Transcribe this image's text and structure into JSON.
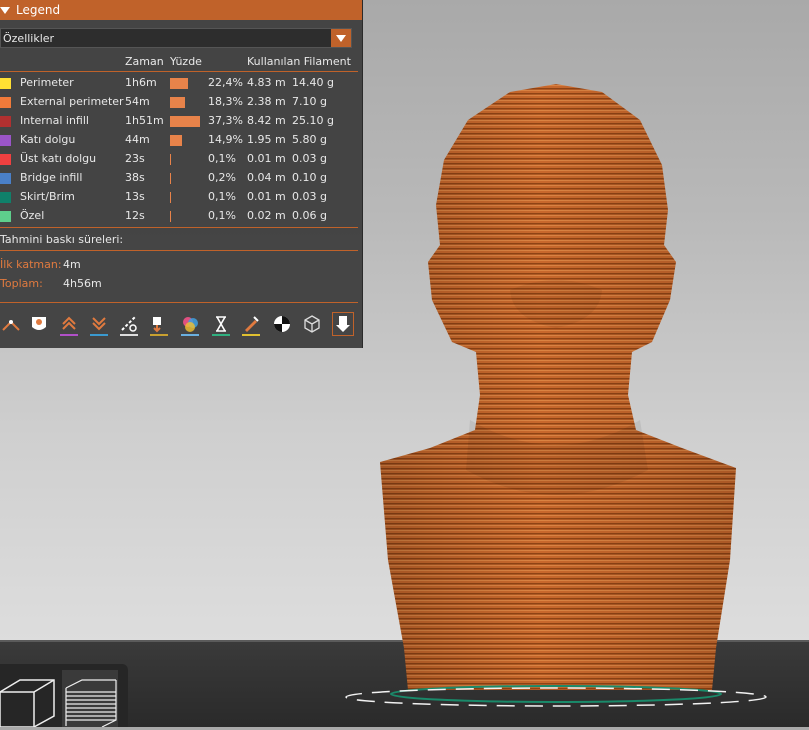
{
  "legend": {
    "title": "Legend",
    "view_select": "Özellikler",
    "columns": {
      "time": "Zaman",
      "percent": "Yüzde",
      "filament": "Kullanılan Filament"
    },
    "rows": [
      {
        "name": "Perimeter",
        "color": "#ffe033",
        "time": "1h6m",
        "percent_value": 22.4,
        "percent": "22,4%",
        "length": "4.83 m",
        "weight": "14.40 g"
      },
      {
        "name": "External perimeter",
        "color": "#f07a3a",
        "time": "54m",
        "percent_value": 18.3,
        "percent": "18,3%",
        "length": "2.38 m",
        "weight": "7.10 g"
      },
      {
        "name": "Internal infill",
        "color": "#b03030",
        "time": "1h51m",
        "percent_value": 37.3,
        "percent": "37,3%",
        "length": "8.42 m",
        "weight": "25.10 g"
      },
      {
        "name": "Katı dolgu",
        "color": "#9a55c8",
        "time": "44m",
        "percent_value": 14.9,
        "percent": "14,9%",
        "length": "1.95 m",
        "weight": "5.80 g"
      },
      {
        "name": "Üst katı dolgu",
        "color": "#f04040",
        "time": "23s",
        "percent_value": 0.1,
        "percent": "0,1%",
        "length": "0.01 m",
        "weight": "0.03 g"
      },
      {
        "name": "Bridge infill",
        "color": "#4a80c8",
        "time": "38s",
        "percent_value": 0.2,
        "percent": "0,2%",
        "length": "0.04 m",
        "weight": "0.10 g"
      },
      {
        "name": "Skirt/Brim",
        "color": "#10806a",
        "time": "13s",
        "percent_value": 0.1,
        "percent": "0,1%",
        "length": "0.01 m",
        "weight": "0.03 g"
      },
      {
        "name": "Özel",
        "color": "#5ecf8c",
        "time": "12s",
        "percent_value": 0.1,
        "percent": "0,1%",
        "length": "0.02 m",
        "weight": "0.06 g"
      }
    ],
    "estimate_title": "Tahmini baskı süreleri:",
    "first_layer_label": "İlk katman:",
    "first_layer_value": "4m",
    "total_label": "Toplam:",
    "total_value": "4h56m",
    "accent": "#c0622a"
  },
  "toolbar_icons": [
    "travel-icon",
    "wipe-icon",
    "retractions-icon",
    "deretractions-icon",
    "seams-icon",
    "tool-changes-icon",
    "color-changes-icon",
    "pause-prints-icon",
    "custom-gcodes-icon",
    "center-of-gravity-icon",
    "shells-icon",
    "tool-marker-icon"
  ],
  "view_widget": [
    "3d-view-icon",
    "layers-view-icon"
  ],
  "model_color": "#c8682c"
}
